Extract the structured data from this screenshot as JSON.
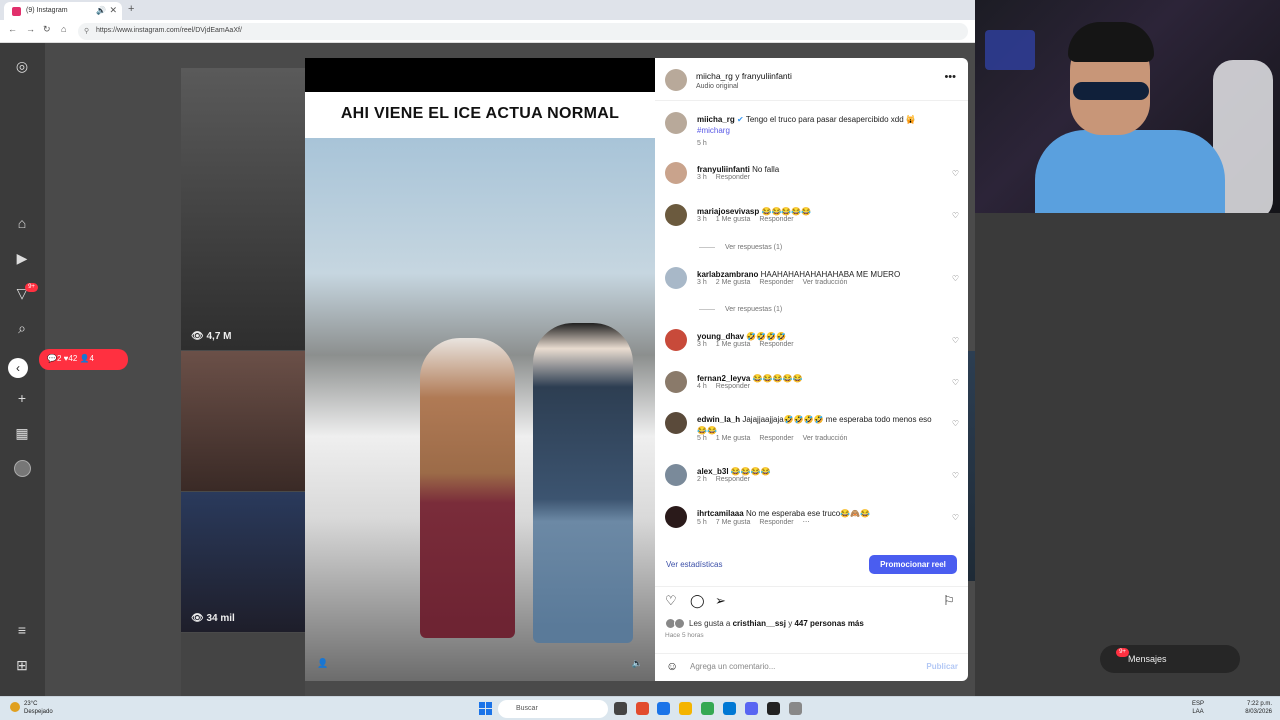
{
  "browser": {
    "tab_title": "(9) Instagram",
    "url": "https://www.instagram.com/reel/DVjdEamAaXf/",
    "new_tab_label": "+"
  },
  "sidebar": {
    "notifications_badge": "9+",
    "notif_pill": "💬2  ♥42  👤4"
  },
  "grid": {
    "tile1_count": "👁 4,7 M",
    "tile2_count": "👁 34 mil"
  },
  "video": {
    "caption": "AHI VIENE EL ICE ACTUA NORMAL"
  },
  "post": {
    "header_title": "miicha_rg y franyuliinfanti",
    "header_sub": "Audio original",
    "author": "miicha_rg",
    "description": "Tengo el truco para pasar desapercibido xdd 🙀",
    "hashtag": "#micharg",
    "time": "5 h",
    "comments": [
      {
        "user": "franyuliinfanti",
        "text": "No falla",
        "time": "3 h",
        "likes": "",
        "reply": "Responder",
        "translate": ""
      },
      {
        "user": "mariajosevivasp",
        "text": "😂😂😂😂😂",
        "time": "3 h",
        "likes": "1 Me gusta",
        "reply": "Responder",
        "translate": "",
        "replies": "Ver respuestas (1)"
      },
      {
        "user": "karlabzambrano",
        "text": "HAAHAHAHAHAHAHABA ME MUERO",
        "time": "3 h",
        "likes": "2 Me gusta",
        "reply": "Responder",
        "translate": "Ver traducción",
        "replies": "Ver respuestas (1)"
      },
      {
        "user": "young_dhav",
        "text": "🤣🤣🤣🤣",
        "time": "3 h",
        "likes": "1 Me gusta",
        "reply": "Responder",
        "translate": ""
      },
      {
        "user": "fernan2_leyva",
        "text": "😂😂😂😂😂",
        "time": "4 h",
        "likes": "",
        "reply": "Responder",
        "translate": ""
      },
      {
        "user": "edwin_la_h",
        "text": "Jajajjaajjaja🤣🤣🤣🤣 me esperaba todo menos eso 😂😂",
        "time": "5 h",
        "likes": "1 Me gusta",
        "reply": "Responder",
        "translate": "Ver traducción"
      },
      {
        "user": "alex_b3l",
        "text": "😂😂😂😂",
        "time": "2 h",
        "likes": "",
        "reply": "Responder",
        "translate": ""
      },
      {
        "user": "ihrtcamilaaa",
        "text": "No me esperaba ese truco😂🙈😂",
        "time": "5 h",
        "likes": "7 Me gusta",
        "reply": "Responder",
        "translate": "⋯"
      }
    ],
    "stats_link": "Ver estadísticas",
    "promote_button": "Promocionar reel",
    "likes_prefix": "Les gusta a",
    "likes_user": "cristhian__ssj",
    "likes_mid": "y",
    "likes_others": "447 personas más",
    "time_ago": "Hace 5 horas",
    "comment_placeholder": "Agrega un comentario...",
    "publish_label": "Publicar"
  },
  "messages": {
    "label": "Mensajes",
    "badge": "9+"
  },
  "taskbar": {
    "temp": "23°C",
    "weather": "Despejado",
    "search_placeholder": "Buscar",
    "lang1": "ESP",
    "lang2": "LAA",
    "time": "7:22 p.m.",
    "date": "8/03/2026",
    "alert_badge": "1"
  },
  "colors": {
    "promote": "#4a5df0",
    "notification": "#ff3040",
    "link": "#3b4fa8"
  }
}
